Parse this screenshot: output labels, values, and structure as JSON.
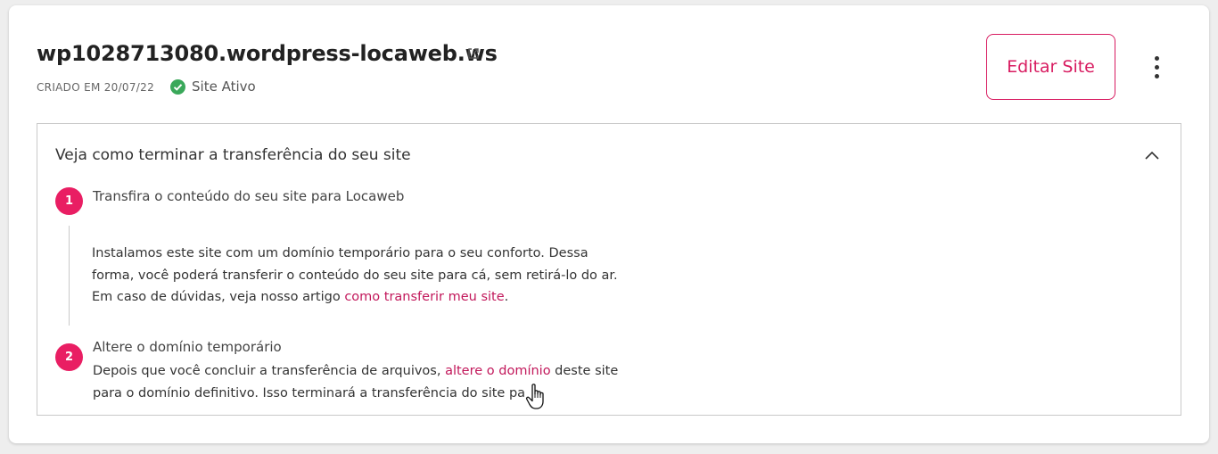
{
  "site": {
    "title": "wp1028713080.wordpress-locaweb.ws",
    "created": "CRIADO EM 20/07/22",
    "status": "Site Ativo"
  },
  "actions": {
    "edit_label": "Editar Site"
  },
  "transfer": {
    "title": "Veja como terminar a transferência do seu site",
    "steps": [
      {
        "number": "1",
        "title": "Transfira o conteúdo do seu site para Locaweb",
        "line1": "Instalamos este site com um domínio temporário para o seu conforto. Dessa",
        "line2": "forma, você poderá transferir o conteúdo do seu site para cá, sem retirá-lo do ar.",
        "line3_before": "Em caso de dúvidas, veja nosso artigo ",
        "line3_link": "como transferir meu site",
        "line3_after": "."
      },
      {
        "number": "2",
        "title": "Altere o domínio temporário",
        "line1_before": "Depois que você concluir a transferência de arquivos, ",
        "line1_link": "altere o domínio",
        "line1_after": " deste site",
        "line2": "para o domínio definitivo. Isso terminará a transferência do site pa"
      }
    ]
  },
  "colors": {
    "accent": "#d81b60",
    "step_badge": "#e91e63",
    "status_ok": "#3aa85a"
  },
  "icons": [
    "external-link-icon",
    "check-icon",
    "kebab-menu-icon",
    "chevron-up-icon",
    "hand-pointer-icon"
  ]
}
